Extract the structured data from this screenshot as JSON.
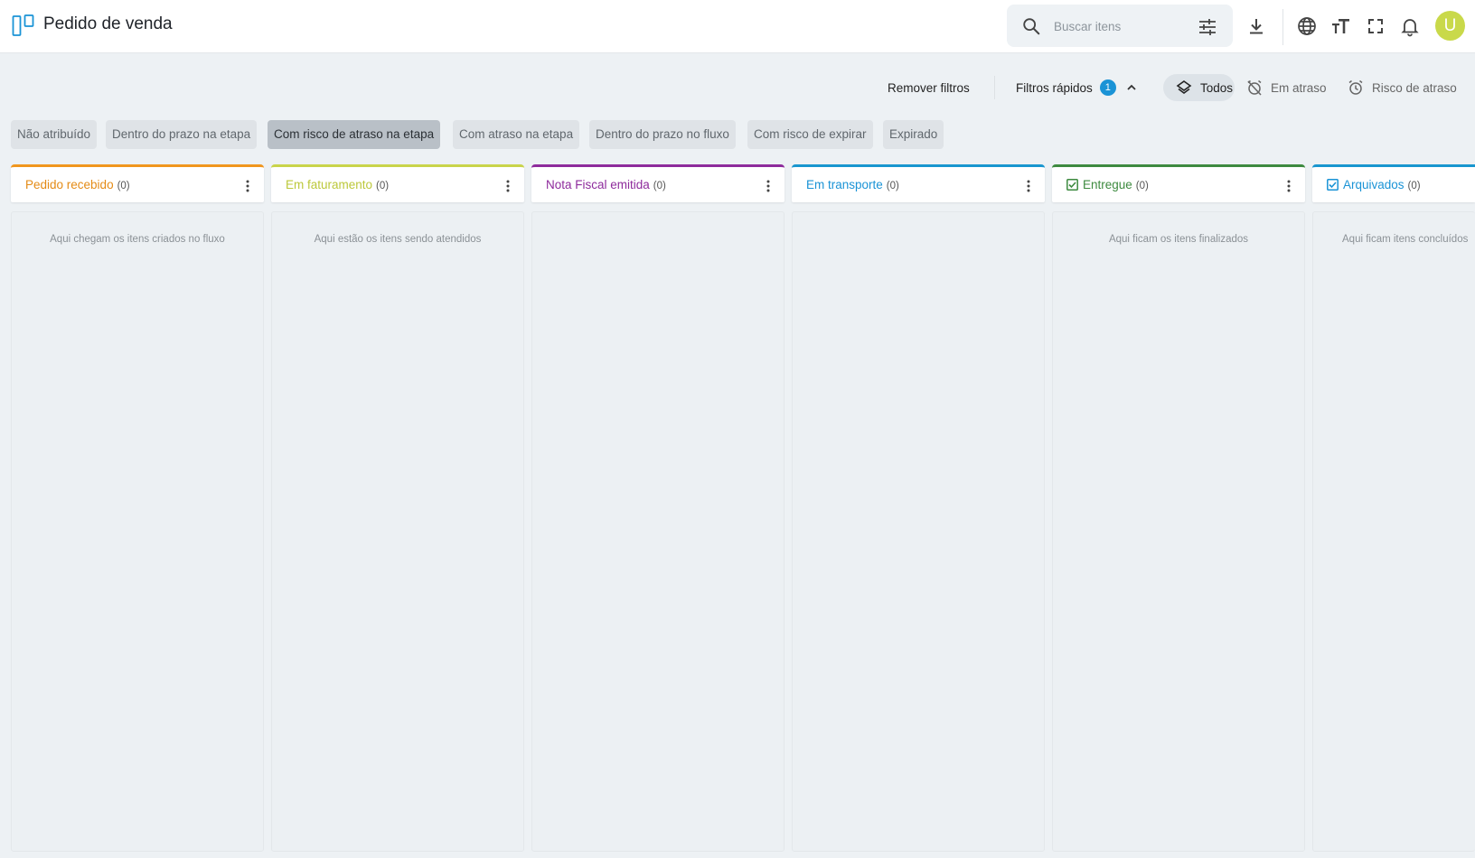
{
  "header": {
    "title": "Pedido de venda",
    "search_placeholder": "Buscar itens",
    "avatar_initial": "U",
    "icons": [
      "board-icon",
      "search-icon",
      "tune-icon",
      "download-icon",
      "globe-icon",
      "text-size-icon",
      "fullscreen-icon",
      "bell-icon"
    ]
  },
  "filters": {
    "remove_label": "Remover filtros",
    "quick_label": "Filtros rápidos",
    "quick_count": "1",
    "views": [
      {
        "label": "Todos",
        "icon": "layers-icon",
        "selected": true
      },
      {
        "label": "Em atraso",
        "icon": "alarm-off-icon",
        "selected": false
      },
      {
        "label": "Risco de atraso",
        "icon": "alarm-icon",
        "selected": false
      }
    ]
  },
  "chips": [
    {
      "label": "Não atribuído",
      "active": false
    },
    {
      "label": "Dentro do prazo na etapa",
      "active": false
    },
    {
      "label": "Com risco de atraso na etapa",
      "active": true
    },
    {
      "label": "Com atraso na etapa",
      "active": false
    },
    {
      "label": "Dentro do prazo no fluxo",
      "active": false
    },
    {
      "label": "Com risco de expirar",
      "active": false
    },
    {
      "label": "Expirado",
      "active": false
    }
  ],
  "columns": [
    {
      "title": "Pedido recebido",
      "count": "(0)",
      "color": "#f0961e",
      "empty_text": "Aqui chegam os itens criados no fluxo"
    },
    {
      "title": "Em faturamento",
      "count": "(0)",
      "color": "#c9d44a",
      "empty_text": "Aqui estão os itens sendo atendidos"
    },
    {
      "title": "Nota Fiscal emitida",
      "count": "(0)",
      "color": "#8e2b9c",
      "empty_text": ""
    },
    {
      "title": "Em transporte",
      "count": "(0)",
      "color": "#1996cf",
      "empty_text": ""
    },
    {
      "title": "Entregue",
      "count": "(0)",
      "color": "#3d8a3f",
      "empty_text": "Aqui ficam os itens finalizados",
      "checked": true
    },
    {
      "title": "Arquivados",
      "count": "(0)",
      "color": "#1996cf",
      "empty_text": "Aqui ficam itens concluídos",
      "checked": true
    }
  ]
}
